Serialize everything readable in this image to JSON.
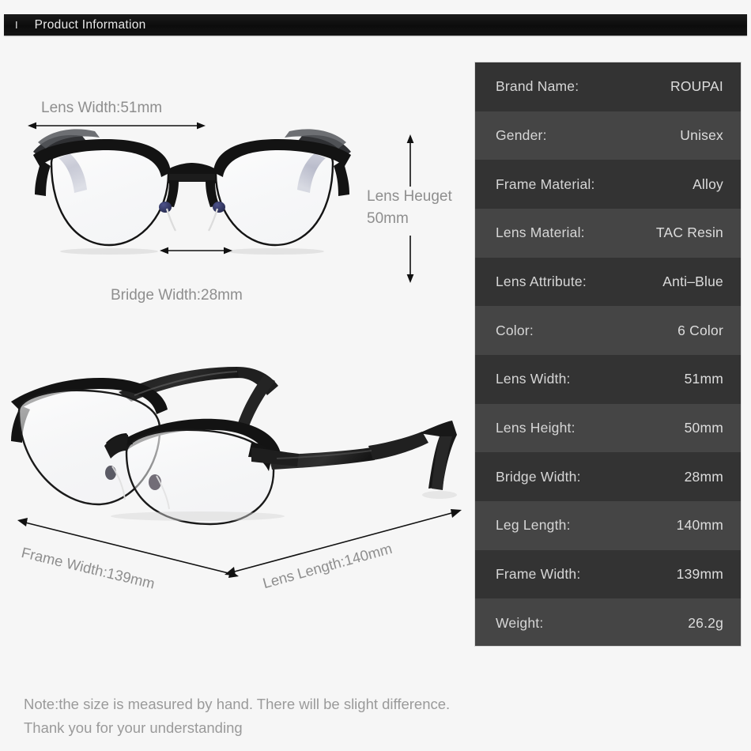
{
  "header": {
    "mark": "I",
    "title": "Product Information"
  },
  "annotations": {
    "lens_width": "Lens Width:51mm",
    "lens_height_line1": "Lens Heuget",
    "lens_height_line2": "50mm",
    "bridge_width": "Bridge Width:28mm",
    "frame_width": "Frame Width:139mm",
    "lens_length": "Lens Length:140mm"
  },
  "spec_table": {
    "rows": [
      {
        "key": "Brand Name:",
        "value": "ROUPAI"
      },
      {
        "key": "Gender:",
        "value": "Unisex"
      },
      {
        "key": "Frame Material:",
        "value": "Alloy"
      },
      {
        "key": "Lens Material:",
        "value": "TAC Resin"
      },
      {
        "key": "Lens Attribute:",
        "value": "Anti–Blue"
      },
      {
        "key": "Color:",
        "value": "6 Color"
      },
      {
        "key": "Lens Width:",
        "value": "51mm"
      },
      {
        "key": "Lens Height:",
        "value": "50mm"
      },
      {
        "key": "Bridge Width:",
        "value": "28mm"
      },
      {
        "key": "Leg Length:",
        "value": "140mm"
      },
      {
        "key": "Frame Width:",
        "value": "139mm"
      },
      {
        "key": "Weight:",
        "value": "26.2g"
      }
    ]
  },
  "note": {
    "line1": "Note:the size is measured by hand. There will be slight difference.",
    "line2": "Thank you for your understanding"
  },
  "colors": {
    "page_background": "#f6f6f6",
    "header_background": "#101010",
    "row_dark": "#333333",
    "row_light": "#454545",
    "annotation_text": "#8e8e8e",
    "frame_black": "#161616",
    "nose_pad_blue": "#3a3f6b"
  }
}
